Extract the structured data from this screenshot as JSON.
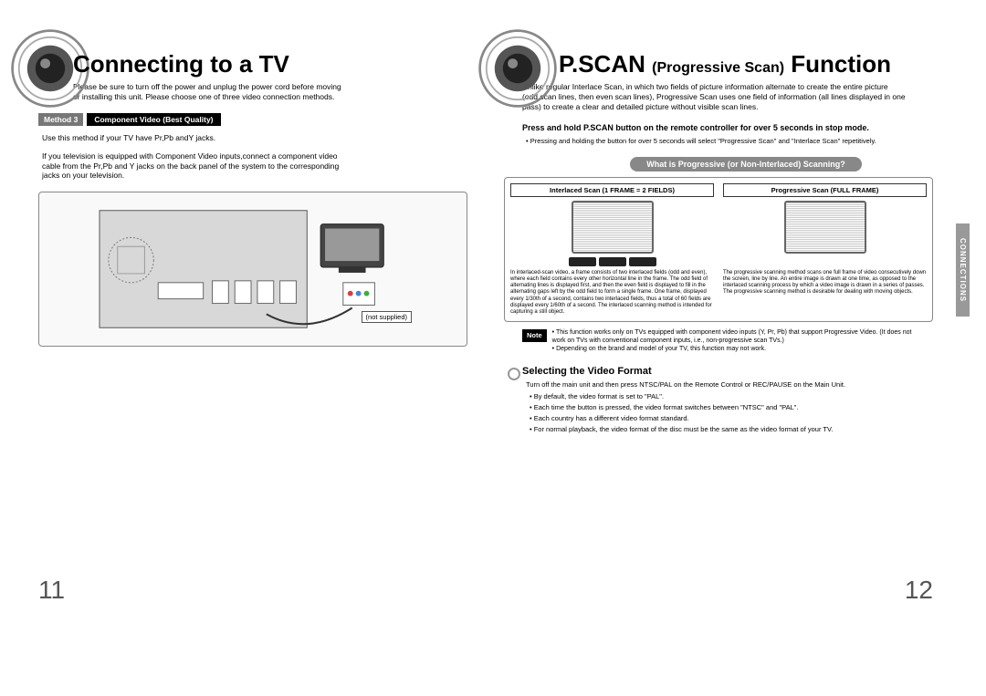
{
  "left": {
    "title": "Connecting to a TV",
    "intro": "Please be sure to turn off the power and unplug the power cord before moving or installing this unit.\nPlease choose one of three video connection methods.",
    "method_badge": "Method 3",
    "method_label": "Component Video (Best Quality)",
    "method_desc": "Use this method if your TV have Pr,Pb andY jacks.",
    "method_detail": "If you television is equipped with Component Video inputs,connect a component video cable from the Pr,Pb and Y jacks on the back panel of the system to the corresponding jacks on your television.",
    "not_supplied": "(not supplied)",
    "page_number": "11"
  },
  "right": {
    "title_main": "P.SCAN ",
    "title_sub": "(Progressive Scan)",
    "title_end": " Function",
    "intro": "Unlike regular Interlace Scan, in which two fields of picture information alternate to create the entire picture (odd scan lines, then even scan lines), Progressive Scan uses one field of information (all lines displayed in one pass) to create a clear and detailed picture without visible scan lines.",
    "instruction": "Press and hold P.SCAN button on the remote controller for over 5 seconds in stop mode.",
    "instruction_bullet": "Pressing and holding the button for over 5 seconds will select \"Progressive Scan\" and \"Interlace Scan\" repetitively.",
    "badge": "What is Progressive (or Non-Interlaced) Scanning?",
    "col1_header": "Interlaced Scan (1 FRAME = 2 FIELDS)",
    "col2_header": "Progressive Scan (FULL FRAME)",
    "col1_text": "In interlaced-scan video, a frame consists of two interlaced fields (odd and even), where each field contains every other horizontal line in the frame. The odd field of alternating lines is displayed first, and then the even field is displayed to fill in the alternating gaps left by the odd field to form a single frame. One frame, displayed every 1/30th of a second, contains two interlaced fields, thus a total of 60 fields are displayed every 1/60th of a second. The interlaced scanning method is intended for capturing a still object.",
    "col2_text": "The progressive scanning method scans one full frame of video consecutively down the screen, line by line. An entire image is drawn at one time, as opposed to the interlaced scanning process by which a video image is drawn in a series of passes. The progressive scanning method is desirable for dealing with moving objects.",
    "note_label": "Note",
    "note1": "This function works only on TVs equipped with component video inputs (Y, Pr, Pb) that support Progressive Video. (It does not work on TVs with conventional component inputs, i.e., non-progressive scan TVs.)",
    "note2": "Depending on the brand and model of your TV, this function may not work.",
    "section2": "Selecting the Video Format",
    "format_intro": "Turn off the main unit and then press NTSC/PAL on the Remote Control or REC/PAUSE on the Main Unit.",
    "fb1": "By default, the video format is set to \"PAL\".",
    "fb2": "Each time the button is pressed, the video format switches between \"NTSC\" and \"PAL\".",
    "fb3": "Each country has a different video format standard.",
    "fb4": "For normal playback, the video format of the disc must be the same as the video format of your TV.",
    "side_tab": "CONNECTIONS",
    "page_number": "12"
  }
}
